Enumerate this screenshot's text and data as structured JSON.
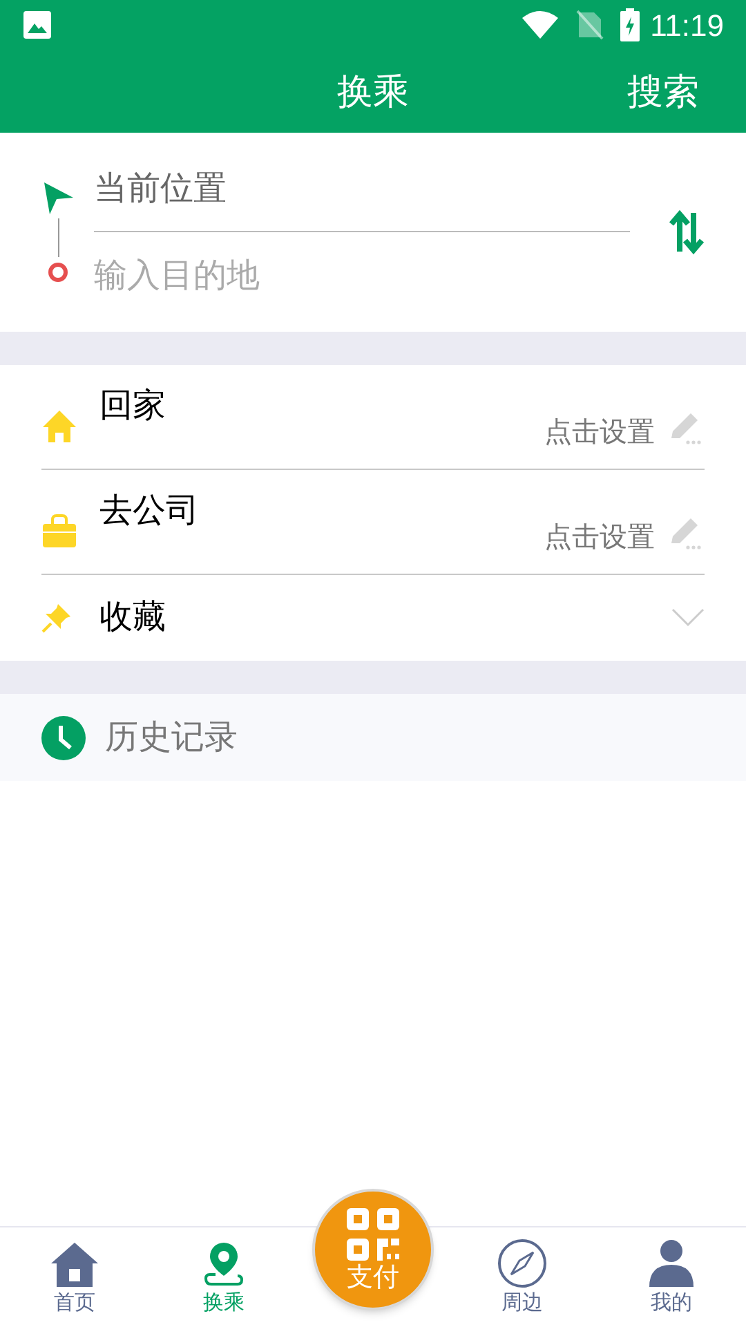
{
  "status_bar": {
    "time": "11:19"
  },
  "header": {
    "title": "换乘",
    "action": "搜索"
  },
  "route": {
    "origin": "当前位置",
    "destination_placeholder": "输入目的地"
  },
  "shortcuts": [
    {
      "kind": "home",
      "label": "回家",
      "hint": "点击设置"
    },
    {
      "kind": "work",
      "label": "去公司",
      "hint": "点击设置"
    }
  ],
  "favorites": {
    "label": "收藏",
    "expanded": false
  },
  "history": {
    "label": "历史记录"
  },
  "tabs": [
    {
      "kind": "home",
      "label": "首页",
      "selected": false
    },
    {
      "kind": "route",
      "label": "换乘",
      "selected": true
    },
    {
      "kind": "pay",
      "label": "支付",
      "selected": false
    },
    {
      "kind": "nearby",
      "label": "周边",
      "selected": false
    },
    {
      "kind": "me",
      "label": "我的",
      "selected": false
    }
  ]
}
